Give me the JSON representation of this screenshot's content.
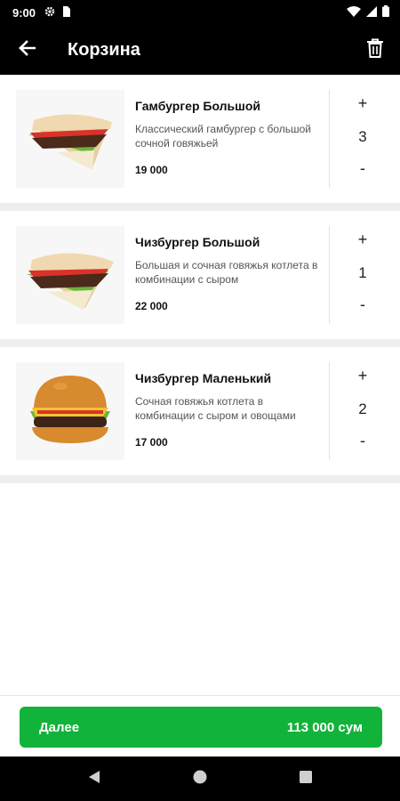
{
  "status_bar": {
    "time": "9:00",
    "icons": [
      "settings-icon",
      "sim-icon",
      "wifi-icon",
      "signal-icon",
      "battery-icon"
    ]
  },
  "app_bar": {
    "title": "Корзина",
    "back_icon": "arrow-left-icon",
    "delete_icon": "trash-icon"
  },
  "cart": {
    "items": [
      {
        "name": "Гамбургер Большой",
        "description": "Классический гамбургер с большой сочной говяжьей",
        "price": "19 000",
        "quantity": "3",
        "plus": "+",
        "minus": "-"
      },
      {
        "name": "Чизбургер Большой",
        "description": "Большая и сочная говяжья котлета в комбинации с сыром",
        "price": "22 000",
        "quantity": "1",
        "plus": "+",
        "minus": "-"
      },
      {
        "name": "Чизбургер Маленький",
        "description": "Сочная говяжья котлета в комбинации с сыром и овощами",
        "price": "17 000",
        "quantity": "2",
        "plus": "+",
        "minus": "-"
      }
    ]
  },
  "checkout": {
    "label": "Далее",
    "total": "113 000 сум",
    "color": "#12b33a"
  },
  "nav_bar": {
    "icons": [
      "back-triangle-icon",
      "home-circle-icon",
      "recents-square-icon"
    ]
  }
}
